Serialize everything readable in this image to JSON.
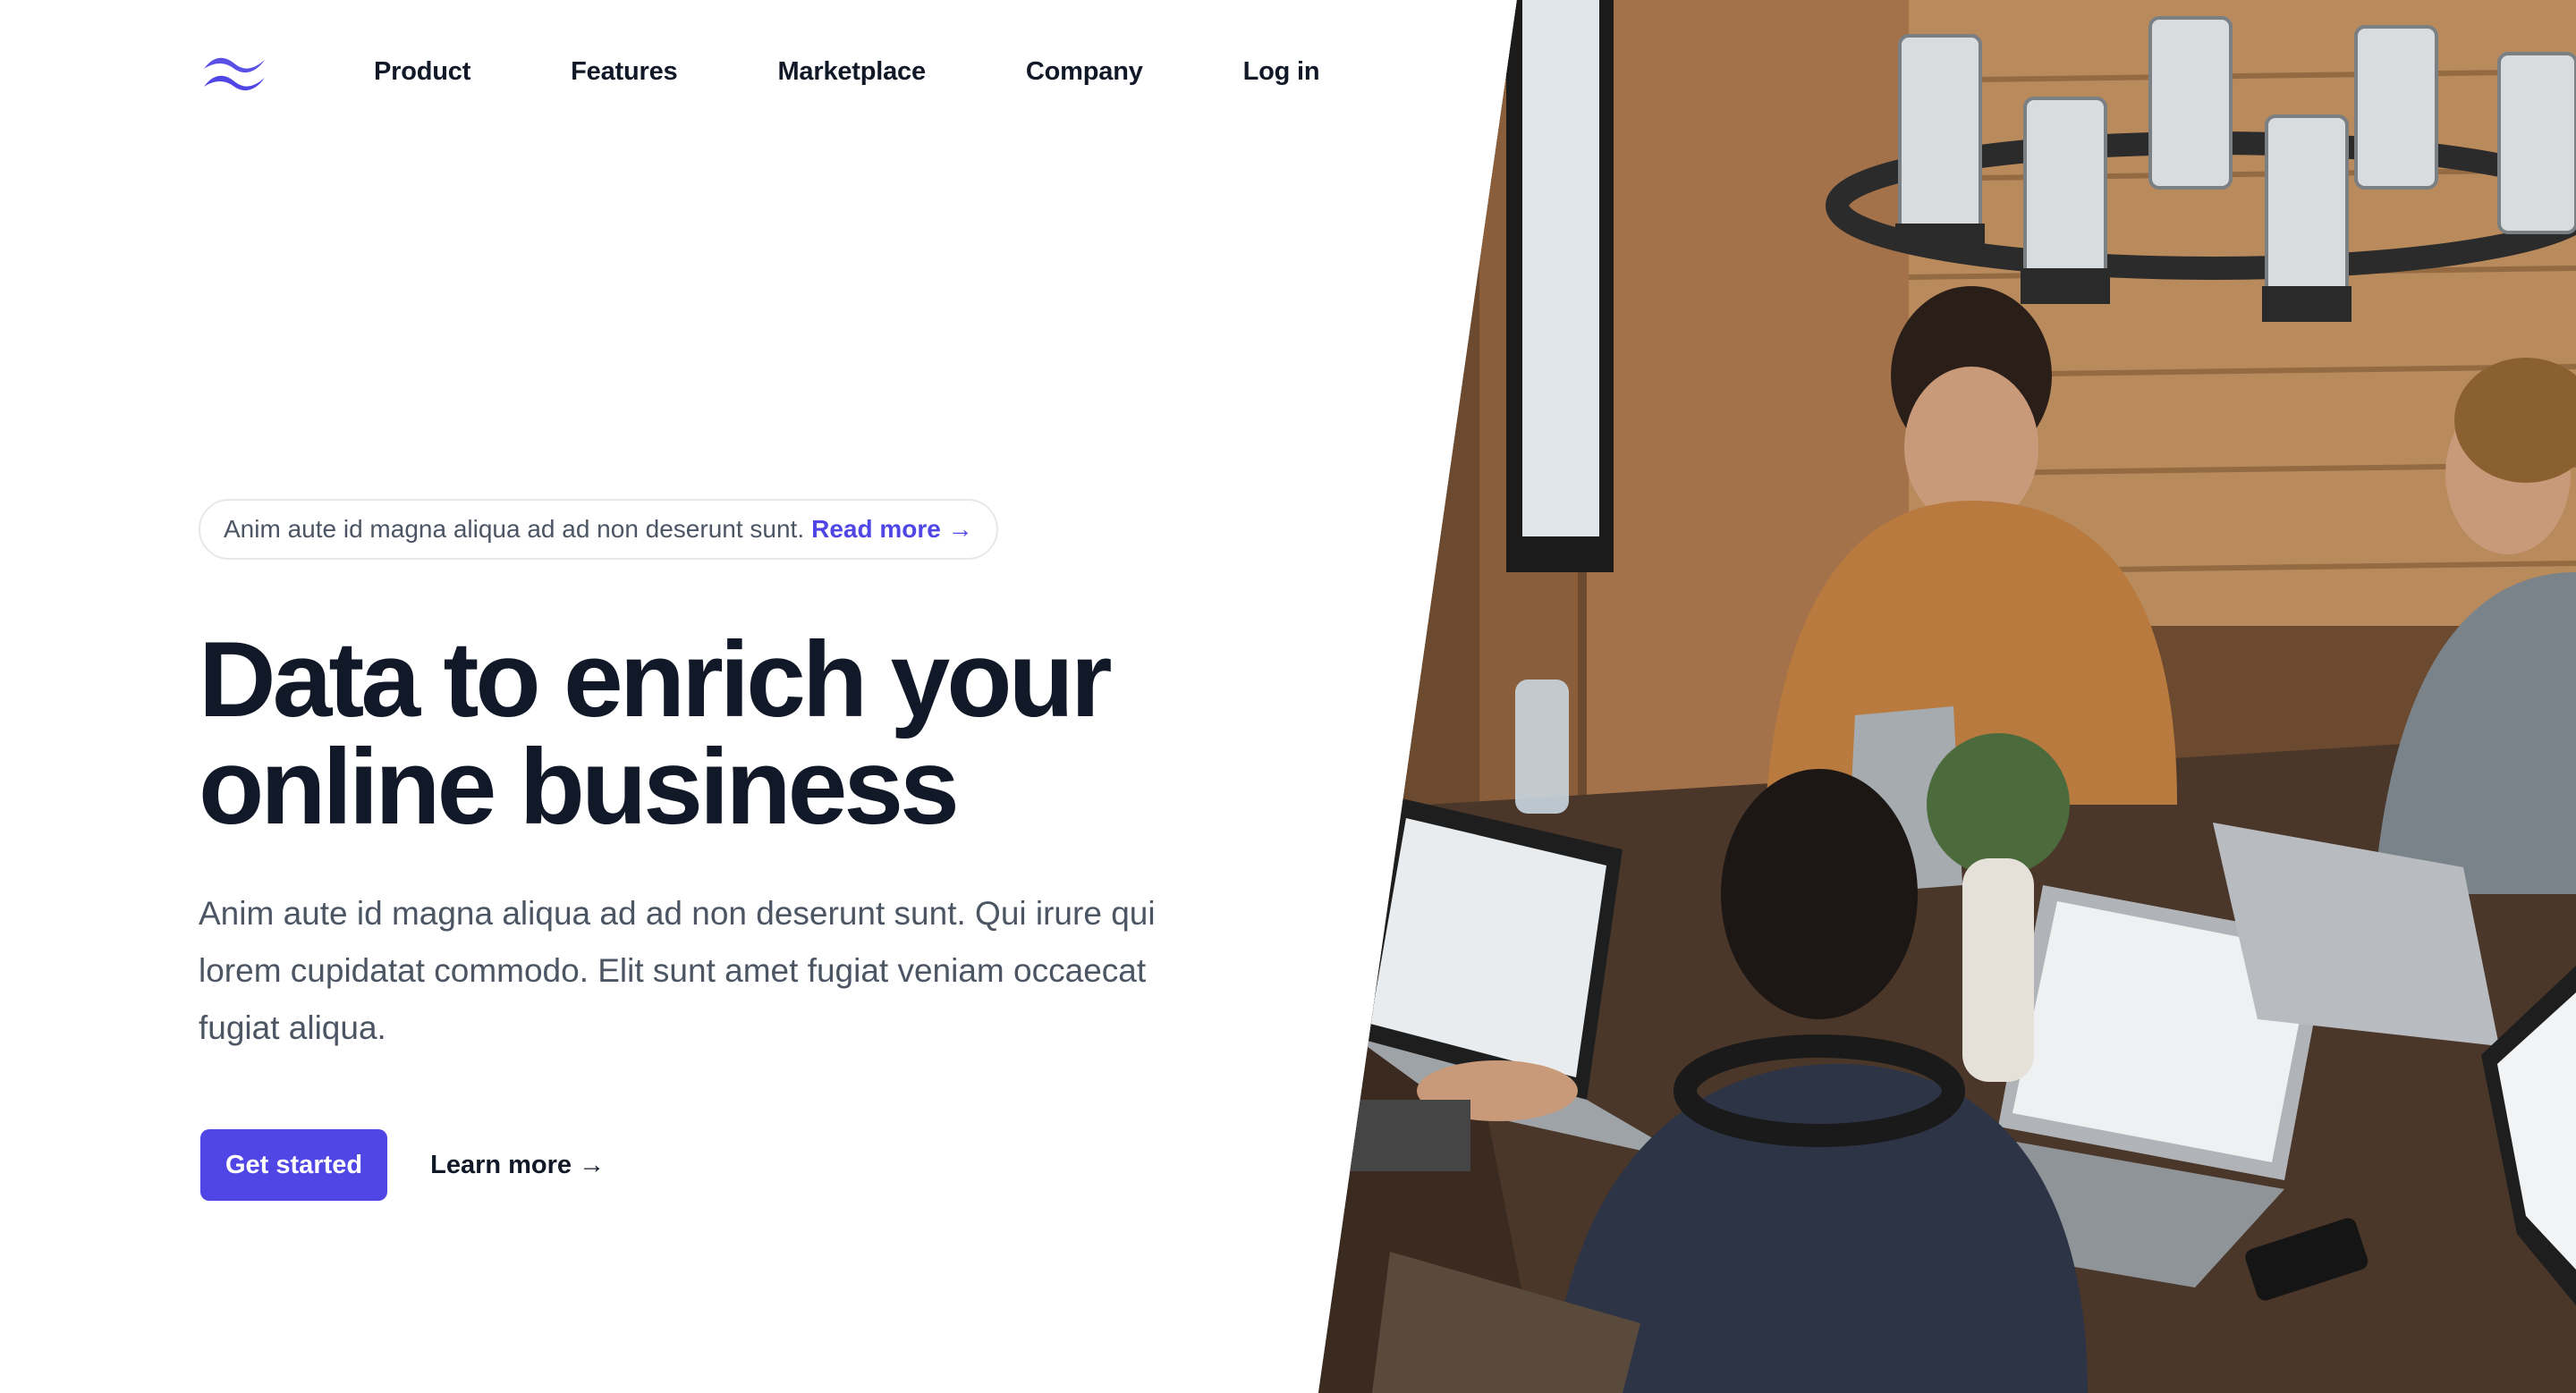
{
  "nav": {
    "logo_icon": "tailwind-waves-icon",
    "items": [
      {
        "label": "Product"
      },
      {
        "label": "Features"
      },
      {
        "label": "Marketplace"
      },
      {
        "label": "Company"
      },
      {
        "label": "Log in"
      }
    ]
  },
  "announcement": {
    "text": "Anim aute id magna aliqua ad ad non deserunt sunt.",
    "link_label": "Read more →"
  },
  "hero": {
    "headline_line1": "Data to enrich your",
    "headline_line2": "online business",
    "description": "Anim aute id magna aliqua ad ad non deserunt sunt. Qui irure qui lorem cupidatat commodo. Elit sunt amet fugiat veniam occaecat fugiat aliqua.",
    "primary_cta": "Get started",
    "secondary_cta": "Learn more →"
  },
  "colors": {
    "accent": "#4f46e5",
    "heading": "#111827",
    "body": "#4b5563",
    "border": "#e5e7eb"
  }
}
